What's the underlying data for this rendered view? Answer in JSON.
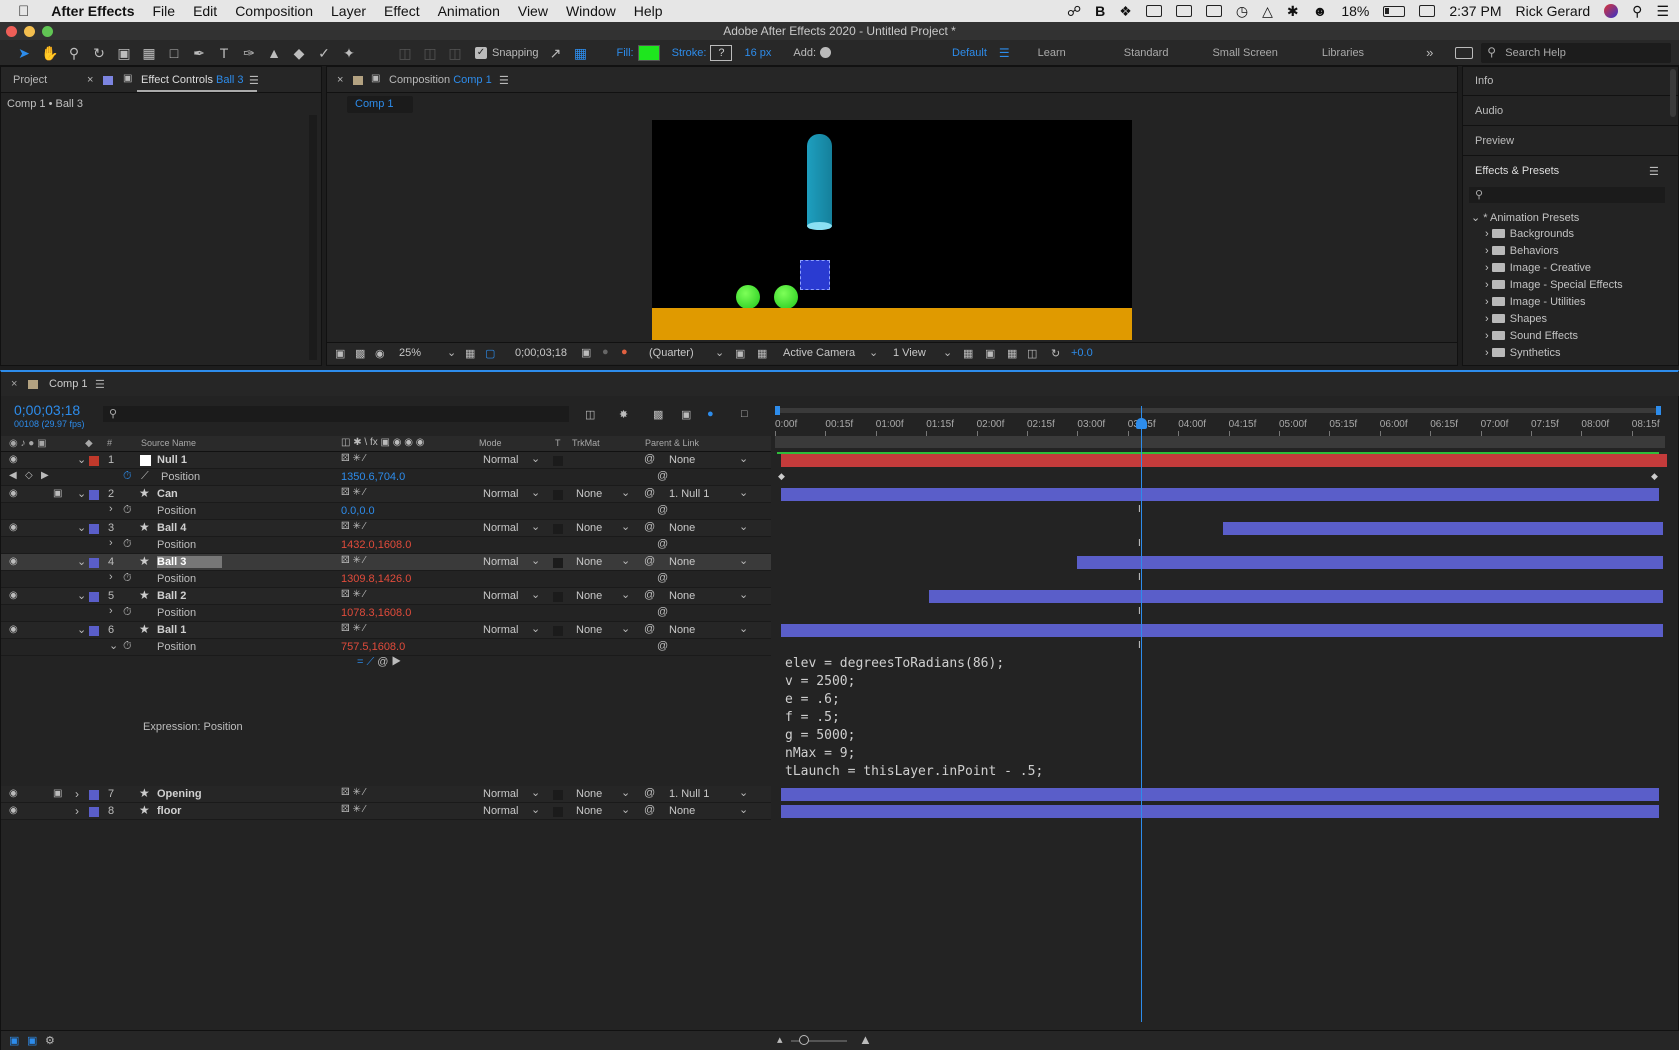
{
  "menubar": {
    "app": "After Effects",
    "items": [
      "File",
      "Edit",
      "Composition",
      "Layer",
      "Effect",
      "Animation",
      "View",
      "Window",
      "Help"
    ],
    "battery": "18%",
    "time": "2:37 PM",
    "user": "Rick Gerard"
  },
  "window": {
    "title": "Adobe After Effects 2020 - Untitled Project *"
  },
  "toolbar": {
    "snapping": "Snapping",
    "fill": "Fill:",
    "stroke": "Stroke:",
    "stroke_value": "?",
    "stroke_px": "16 px",
    "add": "Add:",
    "workspaces": [
      "Default",
      "Learn",
      "Standard",
      "Small Screen",
      "Libraries"
    ],
    "search_placeholder": "Search Help",
    "fill_color": "#1ee61e"
  },
  "left_panel": {
    "tab_project": "Project",
    "tab_effect_controls": "Effect Controls",
    "tab_effect_layer": "Ball 3",
    "breadcrumb": "Comp 1 • Ball 3"
  },
  "comp_panel": {
    "tab_label": "Composition",
    "tab_comp": "Comp 1",
    "subtab": "Comp 1",
    "zoom": "25%",
    "timecode": "0;00;03;18",
    "resolution": "(Quarter)",
    "camera": "Active Camera",
    "views": "1 View",
    "exposure": "+0.0"
  },
  "right_panel": {
    "info": "Info",
    "audio": "Audio",
    "preview": "Preview",
    "effects_presets": "Effects & Presets",
    "root": "* Animation Presets",
    "folders": [
      "Backgrounds",
      "Behaviors",
      "Image - Creative",
      "Image - Special Effects",
      "Image - Utilities",
      "Shapes",
      "Sound Effects",
      "Synthetics"
    ]
  },
  "timeline": {
    "tab": "Comp 1",
    "timecode": "0;00;03;18",
    "fps": "00108 (29.97 fps)",
    "col_source": "Source Name",
    "col_mode": "Mode",
    "col_t": "T",
    "col_trkmat": "TrkMat",
    "col_parent": "Parent & Link",
    "col_num": "#",
    "ruler": [
      "0:00f",
      "00:15f",
      "01:00f",
      "01:15f",
      "02:00f",
      "02:15f",
      "03:00f",
      "03:15f",
      "04:00f",
      "04:15f",
      "05:00f",
      "05:15f",
      "06:00f",
      "06:15f",
      "07:00f",
      "07:15f",
      "08:00f",
      "08:15f"
    ],
    "layers": [
      {
        "num": "1",
        "name": "Null 1",
        "mode": "Normal",
        "trkmat": "",
        "parent": "None",
        "prop": "Position",
        "value": "1350.6,704.0",
        "label_color": "#c0392b"
      },
      {
        "num": "2",
        "name": "Can",
        "mode": "Normal",
        "trkmat": "None",
        "parent": "1. Null 1",
        "prop": "Position",
        "value": "0.0,0.0",
        "label_color": "#5a5ec9"
      },
      {
        "num": "3",
        "name": "Ball 4",
        "mode": "Normal",
        "trkmat": "None",
        "parent": "None",
        "prop": "Position",
        "value": "1432.0,1608.0",
        "label_color": "#5a5ec9"
      },
      {
        "num": "4",
        "name": "Ball 3",
        "mode": "Normal",
        "trkmat": "None",
        "parent": "None",
        "prop": "Position",
        "value": "1309.8,1426.0",
        "label_color": "#5a5ec9"
      },
      {
        "num": "5",
        "name": "Ball 2",
        "mode": "Normal",
        "trkmat": "None",
        "parent": "None",
        "prop": "Position",
        "value": "1078.3,1608.0",
        "label_color": "#5a5ec9"
      },
      {
        "num": "6",
        "name": "Ball 1",
        "mode": "Normal",
        "trkmat": "None",
        "parent": "None",
        "prop": "Position",
        "value": "757.5,1608.0",
        "label_color": "#5a5ec9"
      },
      {
        "num": "7",
        "name": "Opening",
        "mode": "Normal",
        "trkmat": "None",
        "parent": "1. Null 1",
        "label_color": "#5a5ec9"
      },
      {
        "num": "8",
        "name": "floor",
        "mode": "Normal",
        "trkmat": "None",
        "parent": "None",
        "label_color": "#5a5ec9"
      }
    ],
    "expression_label": "Expression: Position",
    "expression_code": [
      "elev = degreesToRadians(86);",
      "v = 2500;",
      "e = .6;",
      "f = .5;",
      "g = 5000;",
      "nMax = 9;",
      "tLaunch = thisLayer.inPoint - .5;"
    ]
  }
}
